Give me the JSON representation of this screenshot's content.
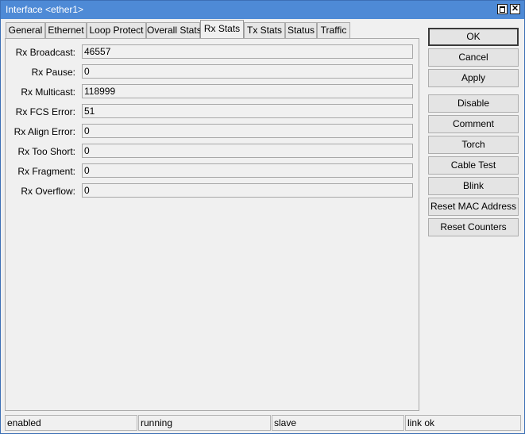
{
  "window": {
    "title": "Interface <ether1>"
  },
  "tabs": [
    {
      "label": "General"
    },
    {
      "label": "Ethernet"
    },
    {
      "label": "Loop Protect"
    },
    {
      "label": "Overall Stats"
    },
    {
      "label": "Rx Stats",
      "active": true
    },
    {
      "label": "Tx Stats"
    },
    {
      "label": "Status"
    },
    {
      "label": "Traffic"
    }
  ],
  "rx_stats": [
    {
      "label": "Rx Broadcast:",
      "value": "46557"
    },
    {
      "label": "Rx Pause:",
      "value": "0"
    },
    {
      "label": "Rx Multicast:",
      "value": "118999"
    },
    {
      "label": "Rx FCS Error:",
      "value": "51"
    },
    {
      "label": "Rx Align Error:",
      "value": "0"
    },
    {
      "label": "Rx Too Short:",
      "value": "0"
    },
    {
      "label": "Rx Fragment:",
      "value": "0"
    },
    {
      "label": "Rx Overflow:",
      "value": "0"
    }
  ],
  "buttons": [
    {
      "label": "OK"
    },
    {
      "label": "Cancel"
    },
    {
      "label": "Apply"
    },
    {
      "label": "Disable"
    },
    {
      "label": "Comment"
    },
    {
      "label": "Torch"
    },
    {
      "label": "Cable Test"
    },
    {
      "label": "Blink"
    },
    {
      "label": "Reset MAC Address"
    },
    {
      "label": "Reset Counters"
    }
  ],
  "status_bar": [
    "enabled",
    "running",
    "slave",
    "link ok"
  ],
  "colors": {
    "titlebar": "#4e8ad6",
    "window_bg": "#f0f0f0"
  }
}
